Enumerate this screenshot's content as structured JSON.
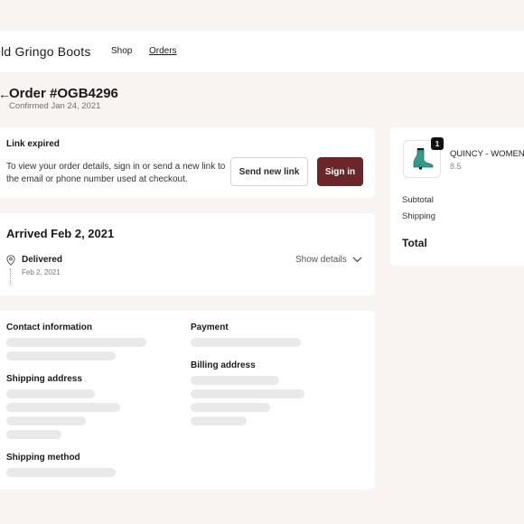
{
  "header": {
    "brand": "Old Gringo Boots",
    "nav": [
      {
        "label": "Shop"
      },
      {
        "label": "Orders"
      }
    ]
  },
  "order": {
    "title": "Order #OGB4296",
    "confirmed": "Confirmed Jan 24, 2021"
  },
  "link_card": {
    "heading": "Link expired",
    "message": "To view your order details, sign in or send a new link to the email or phone number used at checkout.",
    "send_button": "Send new link",
    "signin_button": "Sign in",
    "accent_color": "#6a2629"
  },
  "shipment": {
    "title": "Arrived Feb 2, 2021",
    "status": "Delivered",
    "status_date": "Feb 2, 2021",
    "show_details": "Show details"
  },
  "info": {
    "contact_label": "Contact information",
    "payment_label": "Payment",
    "shipping_address_label": "Shipping address",
    "billing_address_label": "Billing address",
    "shipping_method_label": "Shipping method"
  },
  "summary": {
    "item_qty": "1",
    "item_name": "QUINCY - WOMEN",
    "item_variant": "8.5",
    "subtotal_label": "Subtotal",
    "shipping_label": "Shipping",
    "total_label": "Total",
    "item_icon": "boot-icon"
  }
}
